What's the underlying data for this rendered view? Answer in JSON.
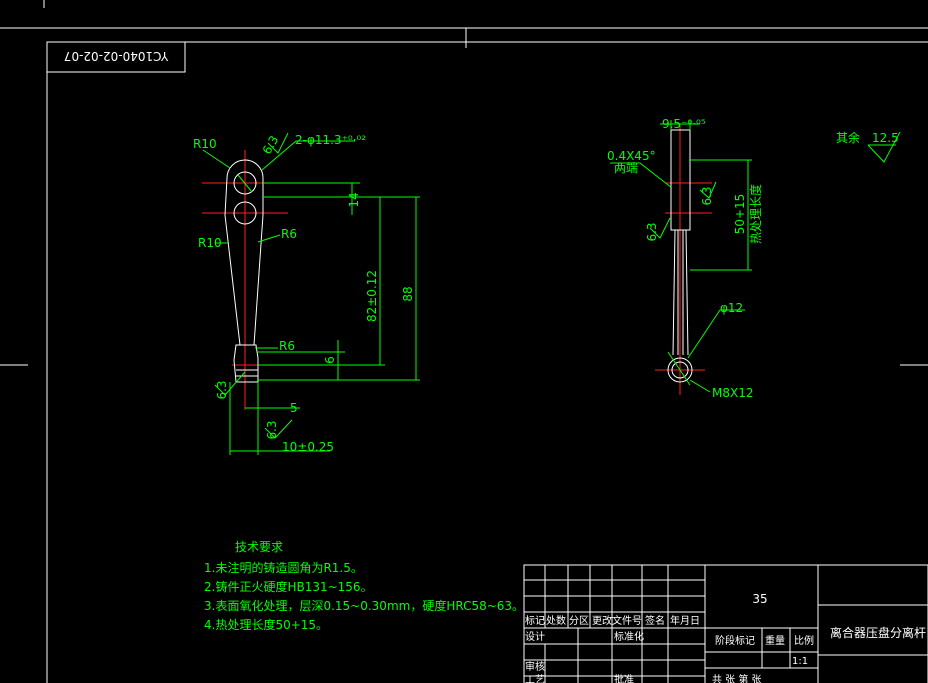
{
  "drawing": {
    "code": "YC1040-02-02-07",
    "part_name": "离合器压盘分离杆",
    "material": "35",
    "scale": "1:1",
    "roughness_other": "其余",
    "roughness_other_value": "12.5"
  },
  "front_view": {
    "r10_top": "R10",
    "holes": "2-φ11.3⁺⁰·⁰²",
    "r10_mid": "R10",
    "r6_top": "R6",
    "r6_bottom": "R6",
    "dim_14": "14",
    "dim_82": "82±0.12",
    "dim_88": "88",
    "dim_6": "6",
    "dim_5": "5",
    "dim_10": "10±0.25",
    "rough_63_a": "6.3",
    "rough_63_b": "6.3",
    "rough_63_c": "6.3"
  },
  "side_view": {
    "dim_95": "9.5⁻⁰·⁰⁵",
    "chamfer": "0.4X45°",
    "chamfer_note": "两端",
    "dim_50": "50+15",
    "dim_50_note": "热处理长度",
    "dia_12": "φ12",
    "thread": "M8X12",
    "rough_63_a": "6.3",
    "rough_63_b": "6.3"
  },
  "tech_req": {
    "title": "技术要求",
    "items": [
      "1.未注明的铸造圆角为R1.5。",
      "2.铸件正火硬度HB131~156。",
      "3.表面氧化处理，层深0.15~0.30mm，硬度HRC58~63。",
      "4.热处理长度50+15。"
    ]
  },
  "title_block": {
    "row1": [
      "标记",
      "处数",
      "分区",
      "更改文件号",
      "签名",
      "年月日"
    ],
    "design": "设计",
    "standardize": "标准化",
    "review": "审核",
    "process": "工艺",
    "approve": "批准",
    "stage_mark": "阶段标记",
    "weight": "重量",
    "ratio": "比例",
    "sheets": "共  张 第  张"
  }
}
